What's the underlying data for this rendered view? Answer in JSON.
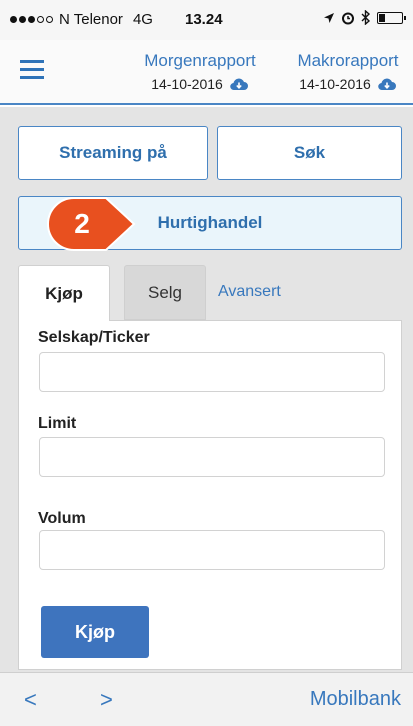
{
  "status_bar": {
    "carrier": "N Telenor",
    "network": "4G",
    "time": "13.24",
    "battery_level": 0.25
  },
  "header": {
    "menu_icon": "hamburger-menu-icon",
    "reports": [
      {
        "title": "Morgenrapport",
        "date": "14-10-2016",
        "icon": "cloud-download-icon"
      },
      {
        "title": "Makrorapport",
        "date": "14-10-2016",
        "icon": "cloud-download-icon"
      }
    ]
  },
  "actions": {
    "streaming": "Streaming på",
    "search": "Søk",
    "quick_trade": "Hurtighandel"
  },
  "badge": {
    "number": "2",
    "color": "#e8501f"
  },
  "tabs": {
    "buy": "Kjøp",
    "sell": "Selg",
    "advanced": "Avansert"
  },
  "form": {
    "company_label": "Selskap/Ticker",
    "company_value": "",
    "limit_label": "Limit",
    "limit_value": "",
    "volume_label": "Volum",
    "volume_value": "",
    "submit_label": "Kjøp"
  },
  "bottom_bar": {
    "back": "<",
    "forward": ">",
    "mobilbank": "Mobilbank"
  },
  "colors": {
    "accent": "#3878bd",
    "button_blue": "#3e74be",
    "badge_orange": "#e8501f"
  }
}
